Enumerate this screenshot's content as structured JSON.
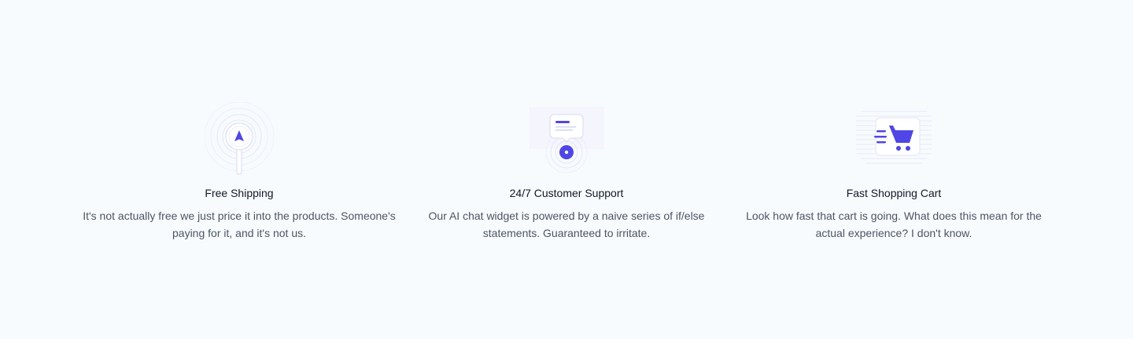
{
  "features": [
    {
      "icon": "location-pin-icon",
      "title": "Free Shipping",
      "description": "It's not actually free we just price it into the products. Someone's paying for it, and it's not us."
    },
    {
      "icon": "chat-bubble-icon",
      "title": "24/7 Customer Support",
      "description": "Our AI chat widget is powered by a naive series of if/else statements. Guaranteed to irritate."
    },
    {
      "icon": "shopping-cart-icon",
      "title": "Fast Shopping Cart",
      "description": "Look how fast that cart is going. What does this mean for the actual experience? I don't know."
    }
  ],
  "colors": {
    "accent": "#4f46e5",
    "background": "#f8fbfe",
    "title": "#111827",
    "text": "#4b5563"
  }
}
